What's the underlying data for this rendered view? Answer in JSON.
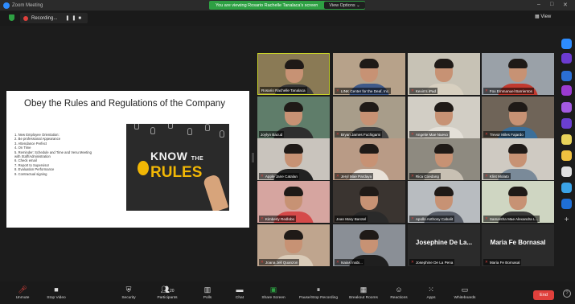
{
  "window": {
    "title": "Zoom Meeting",
    "minimize": "–",
    "maximize": "□",
    "close": "✕"
  },
  "share_banner": {
    "text": "You are viewing Rosario Rachelle Tanalaca's screen",
    "view_options": "View Options"
  },
  "recording": {
    "label": "Recording...",
    "pause": "❚❚",
    "stop": "■"
  },
  "view_button": "View",
  "slide": {
    "title": "Obey the Rules and Regulations of the Company",
    "items": [
      "1.  New Employee Orientation:",
      "2.  Be professional Appearance",
      "3.  Attendance Perfect",
      "4.  On Time",
      "5.  Reminder: Schedule and Time and Venu  Meeting",
      "     with Staff/Administration",
      "6.  Check email",
      "7.  Report to Supervisor",
      "8.  Evaluation Performance",
      "9.  Contractual signing"
    ],
    "image_text": {
      "know": "KNOW",
      "the": "THE",
      "rules": "RULES"
    }
  },
  "participants": [
    {
      "name": "Rosario Rachelle Tanalaca",
      "muted": false,
      "active": true,
      "bg": "#8a7a55",
      "shirt": "#3a3a3a"
    },
    {
      "name": "LINK Center for the Deaf, Inc.",
      "muted": true,
      "bg": "#b7a28a",
      "shirt": "#3f5a8a"
    },
    {
      "name": "Kevin's iPad",
      "muted": true,
      "bg": "#c7c2b5",
      "shirt": "#d8d0c0"
    },
    {
      "name": "Fox Emmanuel Barrientos",
      "muted": true,
      "bg": "#9aa1a8",
      "shirt": "#c23a2f"
    },
    {
      "name": "Joylyn Bacud",
      "muted": false,
      "bg": "#5f7d6a",
      "shirt": "#2e2e2e"
    },
    {
      "name": "Bryan James Fuchigami",
      "muted": true,
      "bg": "#a89d8a",
      "shirt": "#444"
    },
    {
      "name": "Angelie Mae Nuevo",
      "muted": true,
      "bg": "#d2cec5",
      "shirt": "#e4e0d8"
    },
    {
      "name": "Trevor Miles Fajardo",
      "muted": true,
      "bg": "#6f6458",
      "shirt": "#3b6f9a"
    },
    {
      "name": "Apple Jane Catalan",
      "muted": true,
      "bg": "#c9c4bd",
      "shirt": "#222"
    },
    {
      "name": "Jeryl Mae Pardaya",
      "muted": true,
      "bg": "#b99b86",
      "shirt": "#e9e2d9"
    },
    {
      "name": "Rica Coedang",
      "muted": true,
      "bg": "#8e8a80",
      "shirt": "#c8c0b3"
    },
    {
      "name": "Klint Molato",
      "muted": true,
      "bg": "#cfcac2",
      "shirt": "#7a8a99"
    },
    {
      "name": "Kimberly Redlobo",
      "muted": true,
      "bg": "#d6a5a0",
      "shirt": "#d54a4a"
    },
    {
      "name": "Joan Mary Barotel",
      "muted": false,
      "bg": "#3a3430",
      "shirt": "#2a2a2a"
    },
    {
      "name": "Apollo Anthony Cabalit",
      "muted": true,
      "bg": "#b8bcc0",
      "shirt": "#5a5f6a"
    },
    {
      "name": "Samantha Mae Alexandra L...",
      "muted": true,
      "bg": "#cfd6c2",
      "shirt": "#3a3a3a"
    },
    {
      "name": "Joana Jell Quanzon",
      "muted": true,
      "bg": "#bfa58e",
      "shirt": "#d9cbb8"
    },
    {
      "name": "Isaias Inabi...",
      "muted": true,
      "bg": "#8a8f96",
      "shirt": "#1f1f1f"
    },
    {
      "name": "Josephine De La Pena",
      "muted": true,
      "display": "Josephine De La...",
      "bg": "#2b2b2b"
    },
    {
      "name": "Maria Fe Bornasal",
      "muted": true,
      "display": "Maria Fe Bornasal",
      "bg": "#2b2b2b"
    }
  ],
  "toolbar": {
    "unmute": "Unmute",
    "stop_video": "Stop Video",
    "security": "Security",
    "participants": "Participants",
    "participants_count": "20",
    "polls": "Polls",
    "chat": "Chat",
    "share_screen": "Share Screen",
    "pause_recording": "Pause/Stop Recording",
    "breakout_rooms": "Breakout Rooms",
    "reactions": "Reactions",
    "apps": "Apps",
    "whiteboards": "Whiteboards",
    "end": "End"
  },
  "colors": {
    "accent_green": "#2ea043",
    "end_red": "#e0403c",
    "active_border": "#c8d22a"
  }
}
